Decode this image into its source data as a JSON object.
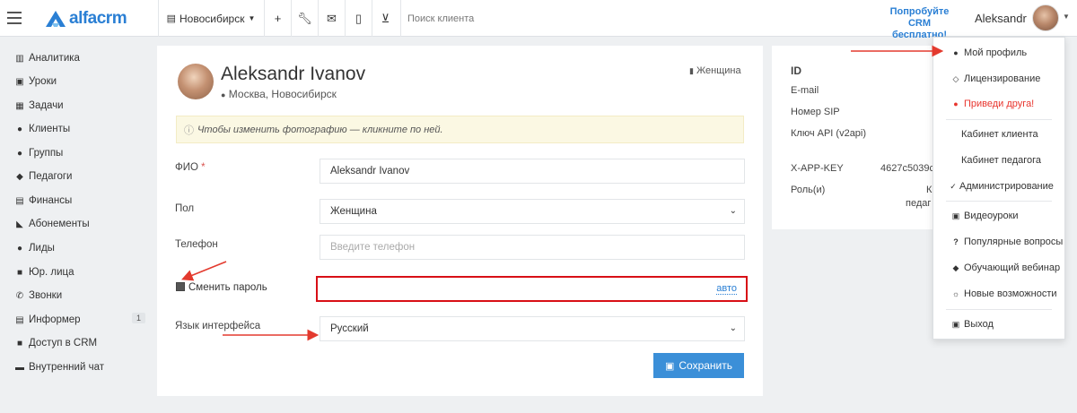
{
  "topbar": {
    "logo_text": "alfacrm",
    "branch_label": "Новосибирск",
    "search_placeholder": "Поиск клиента",
    "try_free_line1": "Попробуйте",
    "try_free_line2": "CRM бесплатно!",
    "user_name": "Aleksandr",
    "icons": [
      "menu-icon",
      "plus-icon",
      "wrench-icon",
      "mail-icon",
      "mobile-icon",
      "cart-icon"
    ]
  },
  "sidebar": {
    "items": [
      {
        "label": "Аналитика",
        "icon": "map-icon"
      },
      {
        "label": "Уроки",
        "icon": "calendar-icon"
      },
      {
        "label": "Задачи",
        "icon": "clipboard-icon"
      },
      {
        "label": "Клиенты",
        "icon": "user-icon"
      },
      {
        "label": "Группы",
        "icon": "users-icon"
      },
      {
        "label": "Педагоги",
        "icon": "graduation-icon"
      },
      {
        "label": "Финансы",
        "icon": "money-icon"
      },
      {
        "label": "Абонементы",
        "icon": "tag-icon"
      },
      {
        "label": "Лиды",
        "icon": "user-plus-icon"
      },
      {
        "label": "Юр. лица",
        "icon": "briefcase-icon"
      },
      {
        "label": "Звонки",
        "icon": "phone-icon"
      },
      {
        "label": "Информер",
        "icon": "database-icon",
        "badge": "1"
      },
      {
        "label": "Доступ в CRM",
        "icon": "lock-icon"
      },
      {
        "label": "Внутренний чат",
        "icon": "chat-icon"
      }
    ]
  },
  "profile": {
    "name": "Aleksandr Ivanov",
    "location": "Москва, Новосибирск",
    "gender": "Женщина",
    "notice": "Чтобы изменить фотографию — кликните по ней."
  },
  "form": {
    "fio_label": "ФИО",
    "fio_required": "*",
    "fio_value": "Aleksandr Ivanov",
    "gender_label": "Пол",
    "gender_value": "Женщина",
    "phone_label": "Телефон",
    "phone_placeholder": "Введите телефон",
    "change_password_label": "Сменить пароль",
    "change_password_checked": true,
    "password_auto": "авто",
    "language_label": "Язык интерфейса",
    "language_value": "Русский",
    "save_label": "Сохранить"
  },
  "info": {
    "id_label": "ID",
    "email_label": "E-mail",
    "sip_label": "Номер SIP",
    "api_label": "Ключ API (v2api)",
    "app_key_label": "X-APP-KEY",
    "app_key_value": "4627c5039c",
    "role_label": "Роль(и)",
    "role_value_line1": "К",
    "role_value_line2": "педаг"
  },
  "dropdown": {
    "items": [
      {
        "label": "Мой профиль",
        "icon": "user-icon"
      },
      {
        "label": "Лицензирование",
        "icon": "lock-icon"
      },
      {
        "label": "Приведи друга!",
        "icon": "users-icon",
        "color": "#e8352e"
      },
      {
        "label": "Кабинет клиента",
        "icon": ""
      },
      {
        "label": "Кабинет педагога",
        "icon": ""
      },
      {
        "label": "Администрирование",
        "icon": "check-icon"
      },
      {
        "label": "Видеоуроки",
        "icon": "video-icon"
      },
      {
        "label": "Популярные вопросы",
        "icon": "question-icon"
      },
      {
        "label": "Обучающий вебинар",
        "icon": "webinar-icon"
      },
      {
        "label": "Новые возможности",
        "icon": "lightbulb-icon"
      },
      {
        "label": "Выход",
        "icon": "exit-icon"
      }
    ]
  },
  "colors": {
    "brand": "#2a7fd4",
    "annotation_red": "#d80f16",
    "save_button": "#3b8fd8",
    "notice_bg": "#fbf8e3"
  }
}
